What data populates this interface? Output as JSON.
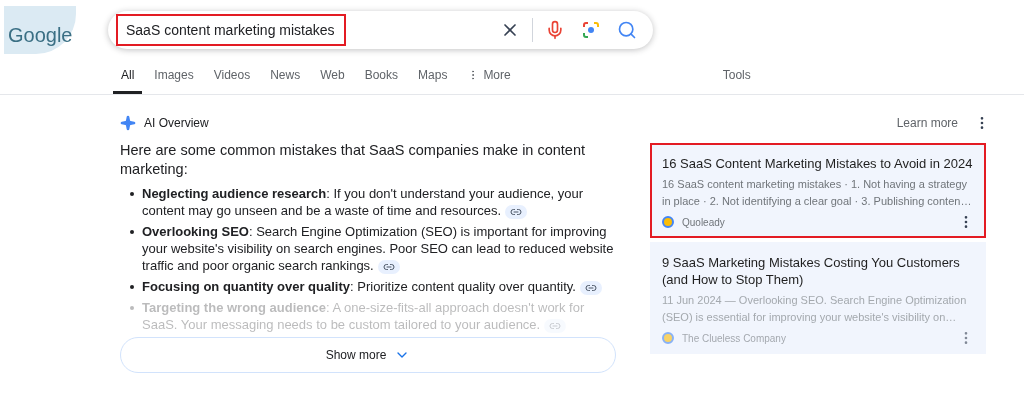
{
  "logo": {
    "text": "Google"
  },
  "search": {
    "value": "SaaS content marketing mistakes",
    "highlighted": true
  },
  "tabs": [
    {
      "label": "All",
      "selected": true,
      "kind": "tab"
    },
    {
      "label": "Images",
      "selected": false,
      "kind": "tab"
    },
    {
      "label": "Videos",
      "selected": false,
      "kind": "tab"
    },
    {
      "label": "News",
      "selected": false,
      "kind": "tab"
    },
    {
      "label": "Web",
      "selected": false,
      "kind": "tab"
    },
    {
      "label": "Books",
      "selected": false,
      "kind": "tab"
    },
    {
      "label": "Maps",
      "selected": false,
      "kind": "tab"
    },
    {
      "label": "More",
      "selected": false,
      "kind": "more"
    }
  ],
  "tools": "Tools",
  "ai_overview": {
    "title": "AI Overview",
    "learn_more": "Learn more",
    "intro": "Here are some common mistakes that SaaS companies make in content marketing:",
    "items": [
      {
        "text": "**Neglecting audience research**: If you don't understand your audience, your content may go unseen and be a waste of time and resources.",
        "faded": false
      },
      {
        "text": "**Overlooking SEO**: Search Engine Optimization (SEO) is important for improving your website's visibility on search engines. Poor SEO can lead to reduced website traffic and poor organic search rankings.",
        "faded": false
      },
      {
        "text": "**Focusing on quantity over quality**: Prioritize content quality over quantity.",
        "faded": false
      },
      {
        "text": "**Targeting the wrong audience**: A one-size-fits-all approach doesn't work for SaaS. Your messaging needs to be custom tailored to your audience.",
        "faded": true
      }
    ],
    "show_more": "Show more"
  },
  "sources": [
    {
      "title": "16 SaaS Content Marketing Mistakes to Avoid in 2024",
      "snippet": "16 SaaS content marketing mistakes · 1. Not having a strategy in place · 2. Not identifying a clear goal · 3. Publishing conten…",
      "site": "Quoleady",
      "highlighted": true,
      "faded": false
    },
    {
      "title": "9 SaaS Marketing Mistakes Costing You Customers (and How to Stop Them)",
      "snippet": "11 Jun 2024 — Overlooking SEO. Search Engine Optimization (SEO) is essential for improving your website's visibility on…",
      "site": "The Clueless Company",
      "highlighted": false,
      "faded": true
    }
  ]
}
